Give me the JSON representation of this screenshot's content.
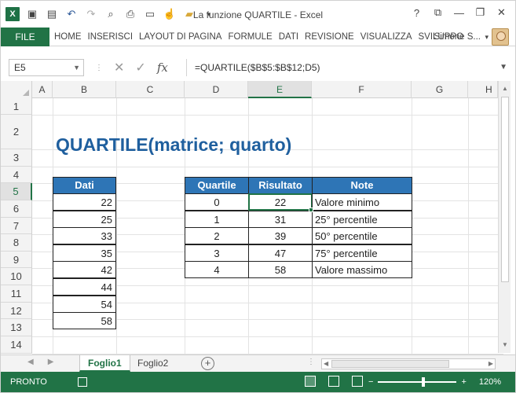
{
  "window": {
    "title": "La funzione QUARTILE - Excel",
    "app_icon": "excel-icon",
    "qat_icons": [
      "save-icon",
      "save-as-icon",
      "undo-icon",
      "redo-icon",
      "print-preview-icon",
      "print-icon",
      "new-icon",
      "touch-icon",
      "open-icon",
      "customize-icon"
    ],
    "controls": [
      "?",
      "⧉",
      "—",
      "❐",
      "✕"
    ]
  },
  "ribbon": {
    "file_label": "FILE",
    "tabs": [
      "HOME",
      "INSERISCI",
      "LAYOUT DI PAGINA",
      "FORMULE",
      "DATI",
      "REVISIONE",
      "VISUALIZZA",
      "SVILUPPO"
    ],
    "user": "Simone S...",
    "accent": "#217346"
  },
  "formula_bar": {
    "name_box": "E5",
    "fx": "fx",
    "formula": "=QUARTILE($B$5:$B$12;D5)"
  },
  "grid": {
    "columns": [
      "A",
      "B",
      "C",
      "D",
      "E",
      "F",
      "G",
      "H"
    ],
    "rows": [
      "1",
      "2",
      "3",
      "4",
      "5",
      "6",
      "7",
      "8",
      "9",
      "10",
      "11",
      "12",
      "13",
      "14"
    ],
    "active_column": "E",
    "active_row": "5"
  },
  "sheet": {
    "title": "QUARTILE(matrice; quarto)",
    "data_header": "Dati",
    "data_values": [
      "22",
      "25",
      "33",
      "35",
      "42",
      "44",
      "54",
      "58"
    ],
    "result_headers": [
      "Quartile",
      "Risultato",
      "Note"
    ],
    "result_rows": [
      [
        "0",
        "22",
        "Valore minimo"
      ],
      [
        "1",
        "31",
        "25° percentile"
      ],
      [
        "2",
        "39",
        "50° percentile"
      ],
      [
        "3",
        "47",
        "75° percentile"
      ],
      [
        "4",
        "58",
        "Valore massimo"
      ]
    ],
    "header_color": "#2e75b6",
    "title_color": "#1f5f9e"
  },
  "sheet_tabs": {
    "tabs": [
      "Foglio1",
      "Foglio2"
    ],
    "active": "Foglio1"
  },
  "status": {
    "text": "PRONTO",
    "zoom": "120%",
    "zoom_out": "−",
    "zoom_in": "+"
  }
}
